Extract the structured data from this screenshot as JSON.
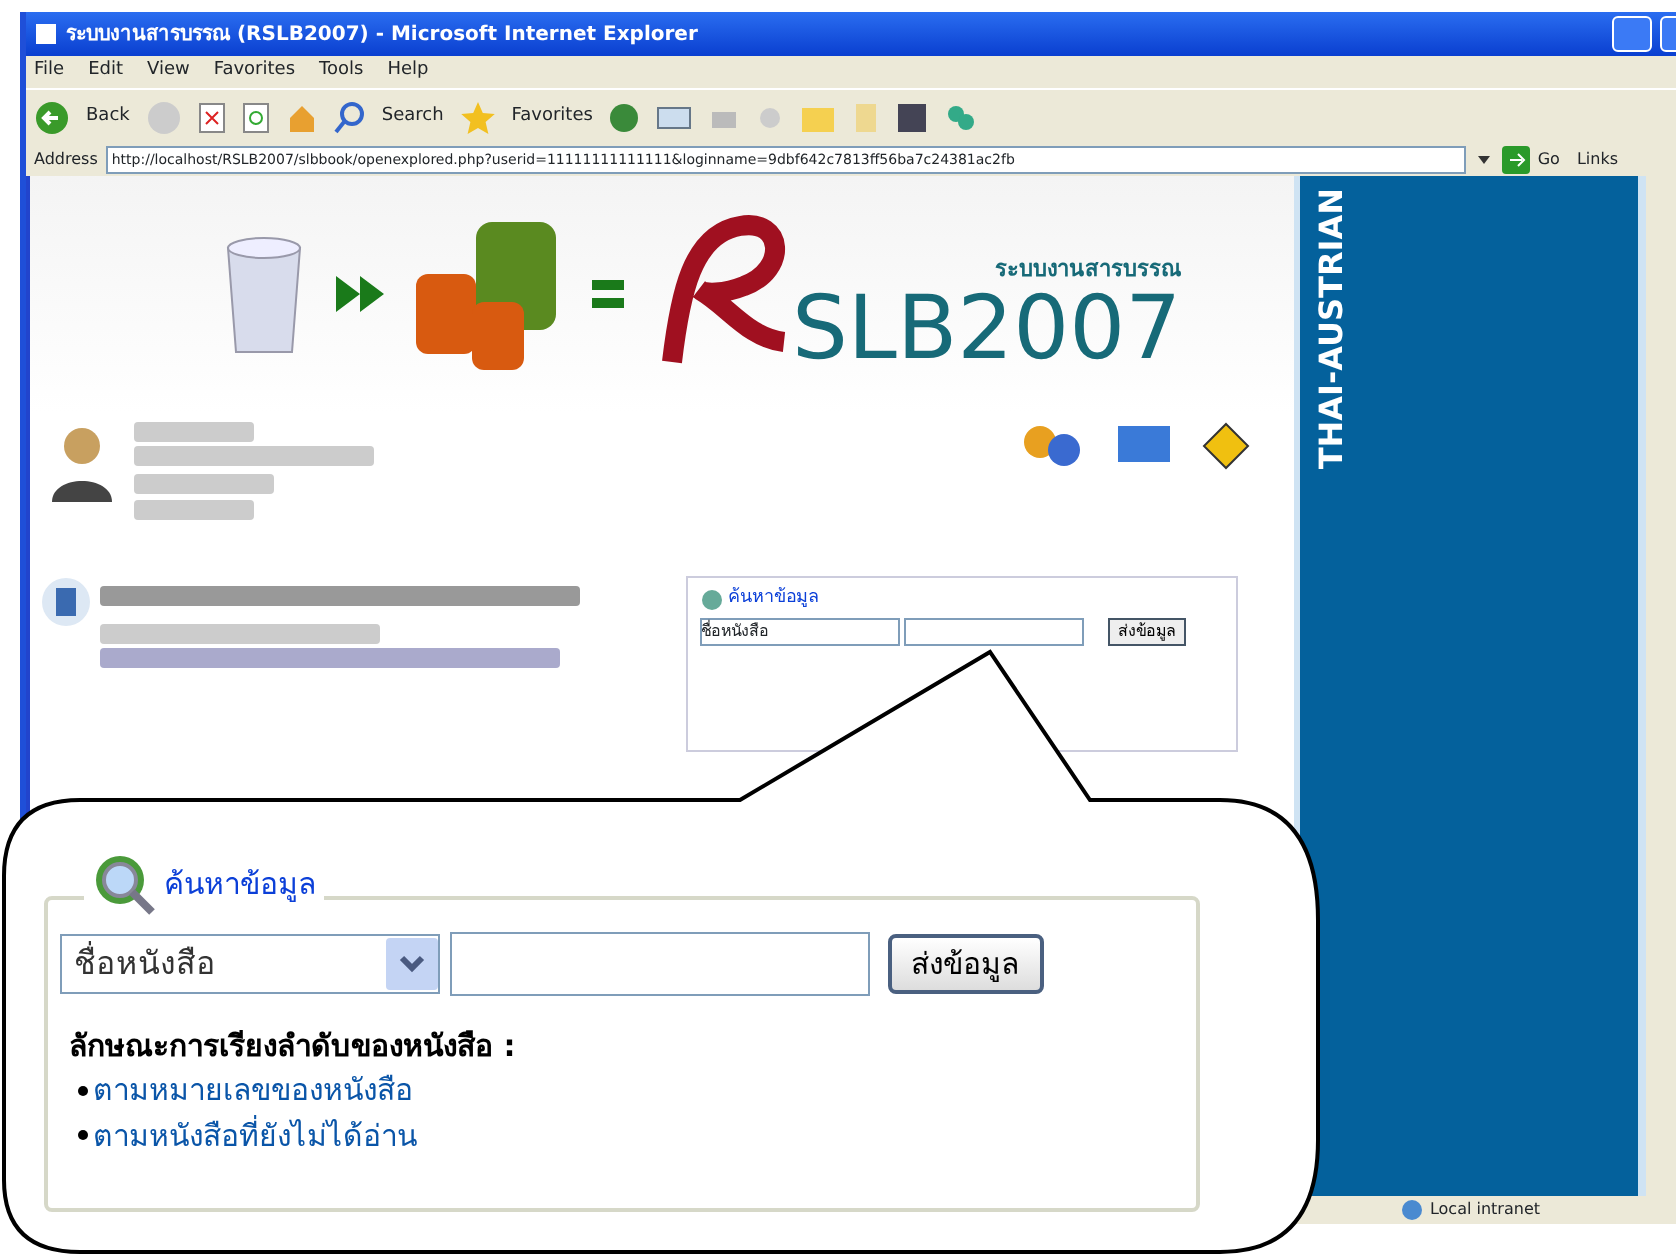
{
  "window": {
    "title": "ระบบงานสารบรรณ (RSLB2007) - Microsoft Internet Explorer"
  },
  "menu": [
    "File",
    "Edit",
    "View",
    "Favorites",
    "Tools",
    "Help"
  ],
  "toolbar": {
    "back": "Back",
    "search": "Search",
    "favorites": "Favorites"
  },
  "address": {
    "label": "Address",
    "url": "http://localhost/RSLB2007/slbbook/openexplored.php?userid=11111111111111&loginname=9dbf642c7813ff56ba7c24381ac2fb",
    "go": "Go",
    "links": "Links"
  },
  "page": {
    "logo": {
      "subtitle": "ระบบงานสารบรรณ",
      "name": "SLB2007"
    },
    "search_box": {
      "legend": "ค้นหาข้อมูล",
      "select": "ชื่อหนังสือ",
      "button": "ส่งข้อมูล"
    },
    "side_banner": "THAI-AUSTRIAN"
  },
  "callout": {
    "legend": "ค้นหาข้อมูล",
    "select": "ชื่อหนังสือ",
    "button": "ส่งข้อมูล",
    "sort_heading": "ลักษณะการเรียงลำดับของหนังสือ :",
    "sort_links": [
      "ตามหมายเลขของหนังสือ",
      "ตามหนังสือที่ยังไม่ได้อ่าน"
    ]
  },
  "status_bar": {
    "zone": "Local intranet"
  }
}
